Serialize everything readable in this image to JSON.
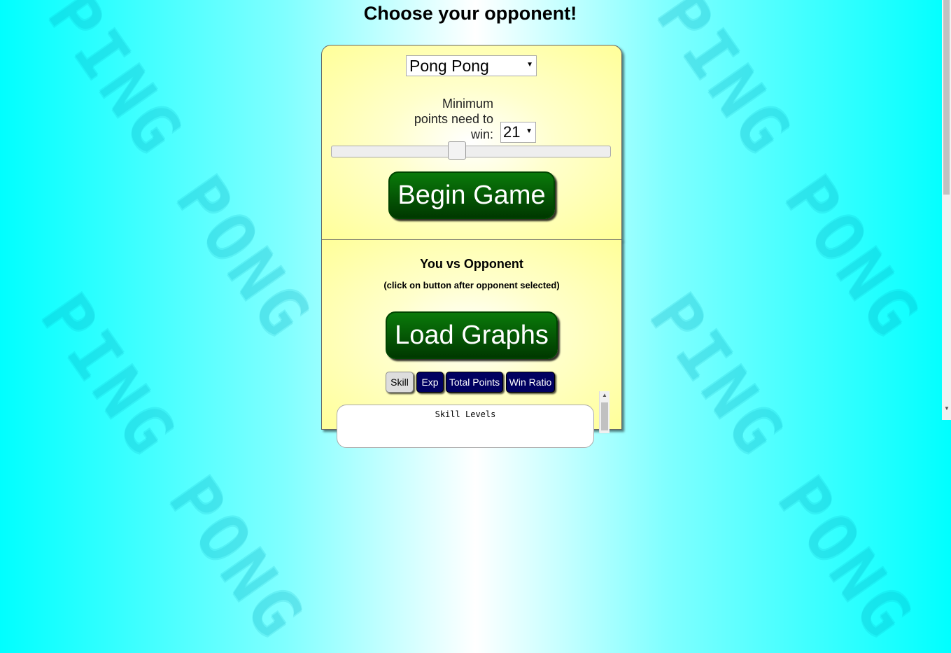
{
  "page": {
    "title": "Choose your opponent!"
  },
  "background": {
    "watermark_text": "PING PONG",
    "colors": {
      "outer": "#00ffff",
      "center": "#ffffff"
    }
  },
  "opponent": {
    "selected": "Pong Pong"
  },
  "points": {
    "label": "Minimum points need to win:",
    "selected": "21",
    "slider_fraction": 0.45
  },
  "begin_button": {
    "label": "Begin Game"
  },
  "graphs": {
    "heading": "You vs Opponent",
    "note": "(click on button after opponent selected)",
    "load_label": "Load Graphs",
    "tabs": [
      {
        "label": "Skill",
        "active": true
      },
      {
        "label": "Exp",
        "active": false
      },
      {
        "label": "Total Points",
        "active": false
      },
      {
        "label": "Win Ratio",
        "active": false
      }
    ],
    "panel_title": "Skill Levels"
  },
  "icons": {
    "dropdown": "triangle-down-icon",
    "scroll_up": "triangle-up-icon",
    "scroll_down": "triangle-down-icon"
  },
  "colors": {
    "button_green": "#0a5a0a",
    "tab_navy": "#000060",
    "panel_yellow": "#ffff99"
  }
}
